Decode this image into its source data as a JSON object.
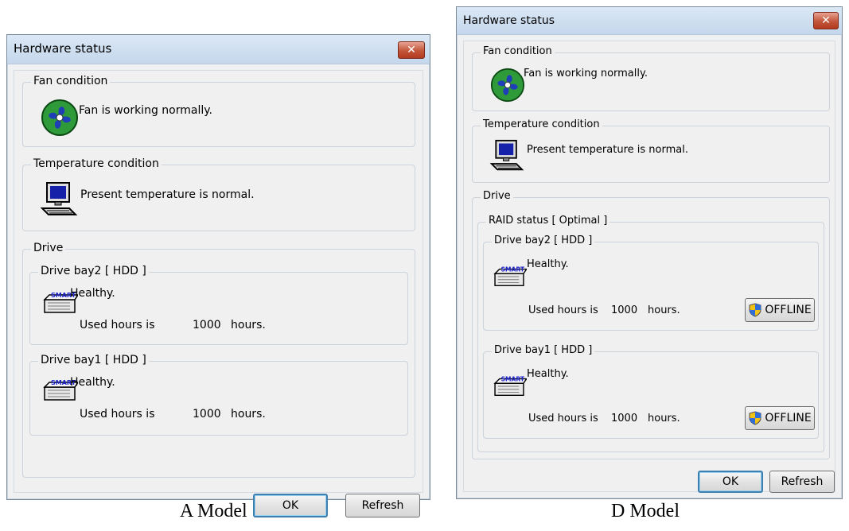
{
  "window_a": {
    "title": "Hardware status",
    "close_glyph": "✕",
    "fan": {
      "legend": "Fan condition",
      "message": "Fan is working normally."
    },
    "temperature": {
      "legend": "Temperature condition",
      "message": "Present temperature is normal."
    },
    "drive": {
      "legend": "Drive",
      "bays": [
        {
          "legend": "Drive bay2 [ HDD ]",
          "smart_label": "SMART",
          "status": "Healthy.",
          "used_label": "Used hours is",
          "hours": "1000",
          "unit": "hours."
        },
        {
          "legend": "Drive bay1 [ HDD ]",
          "smart_label": "SMART",
          "status": "Healthy.",
          "used_label": "Used hours is",
          "hours": "1000",
          "unit": "hours."
        }
      ]
    },
    "buttons": {
      "ok": "OK",
      "refresh": "Refresh"
    }
  },
  "window_d": {
    "title": "Hardware status",
    "close_glyph": "✕",
    "fan": {
      "legend": "Fan condition",
      "message": "Fan is working normally."
    },
    "temperature": {
      "legend": "Temperature condition",
      "message": "Present temperature is normal."
    },
    "drive": {
      "legend": "Drive",
      "raid_legend": "RAID status [ Optimal ]",
      "bays": [
        {
          "legend": "Drive bay2 [ HDD ]",
          "smart_label": "SMART",
          "status": "Healthy.",
          "used_label": "Used hours is",
          "hours": "1000",
          "unit": "hours.",
          "offline": "OFFLINE"
        },
        {
          "legend": "Drive bay1 [ HDD ]",
          "smart_label": "SMART",
          "status": "Healthy.",
          "used_label": "Used hours is",
          "hours": "1000",
          "unit": "hours.",
          "offline": "OFFLINE"
        }
      ]
    },
    "buttons": {
      "ok": "OK",
      "refresh": "Refresh"
    }
  },
  "captions": {
    "a": "A Model",
    "d": "D Model"
  },
  "icons": {
    "fan": "fan-icon",
    "computer": "computer-icon",
    "drive": "smart-drive-icon",
    "shield": "uac-shield-icon"
  }
}
